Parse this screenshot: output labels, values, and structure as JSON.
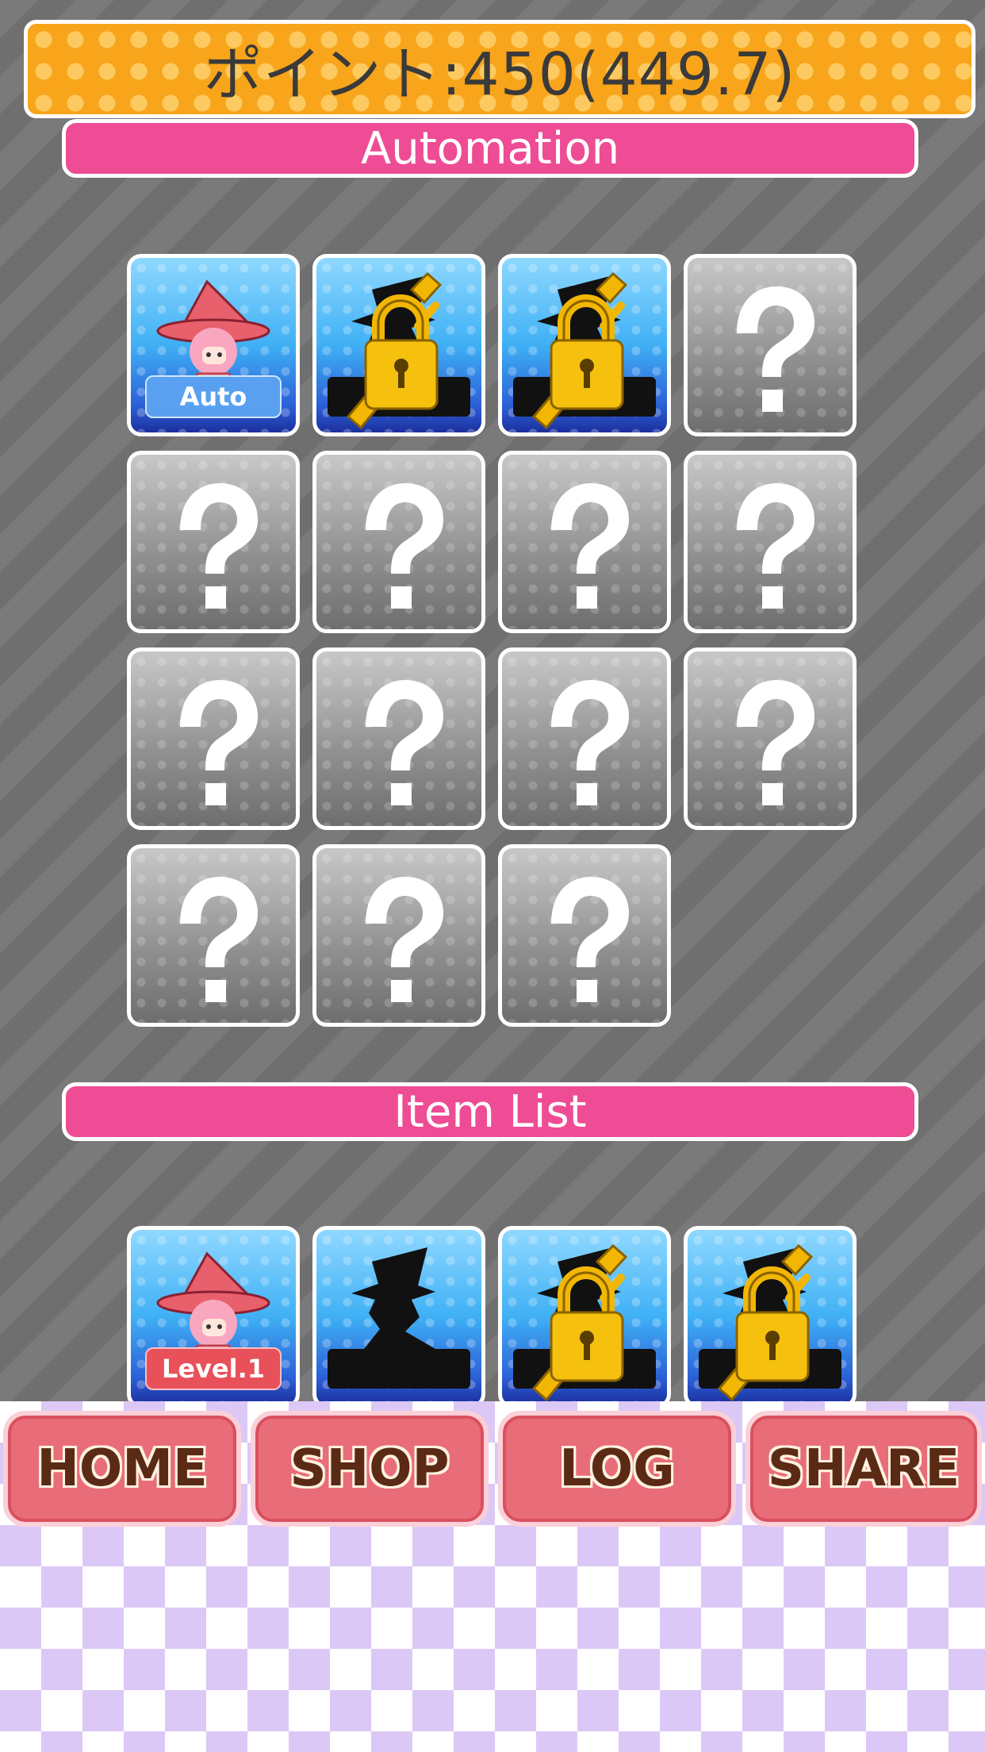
{
  "header": {
    "points_text": "ポイント:450(449.7)"
  },
  "sections": {
    "automation": "Automation",
    "item_list": "Item List"
  },
  "automation_tiles": [
    {
      "type": "character",
      "badge": "Auto"
    },
    {
      "type": "locked"
    },
    {
      "type": "locked"
    },
    {
      "type": "unknown"
    },
    {
      "type": "unknown"
    },
    {
      "type": "unknown"
    },
    {
      "type": "unknown"
    },
    {
      "type": "unknown"
    },
    {
      "type": "unknown"
    },
    {
      "type": "unknown"
    },
    {
      "type": "unknown"
    },
    {
      "type": "unknown"
    },
    {
      "type": "unknown"
    },
    {
      "type": "unknown"
    },
    {
      "type": "unknown"
    }
  ],
  "item_tiles": [
    {
      "type": "character",
      "badge": "Level.1"
    },
    {
      "type": "silhouette"
    },
    {
      "type": "locked"
    },
    {
      "type": "locked"
    }
  ],
  "nav": {
    "home": "HOME",
    "shop": "SHOP",
    "log": "LOG",
    "share": "SHARE"
  },
  "colors": {
    "header_orange": "#f8a51b",
    "section_pink": "#ee4c95",
    "nav_button": "#e96d79",
    "checker_purple": "#dcc8f6"
  }
}
